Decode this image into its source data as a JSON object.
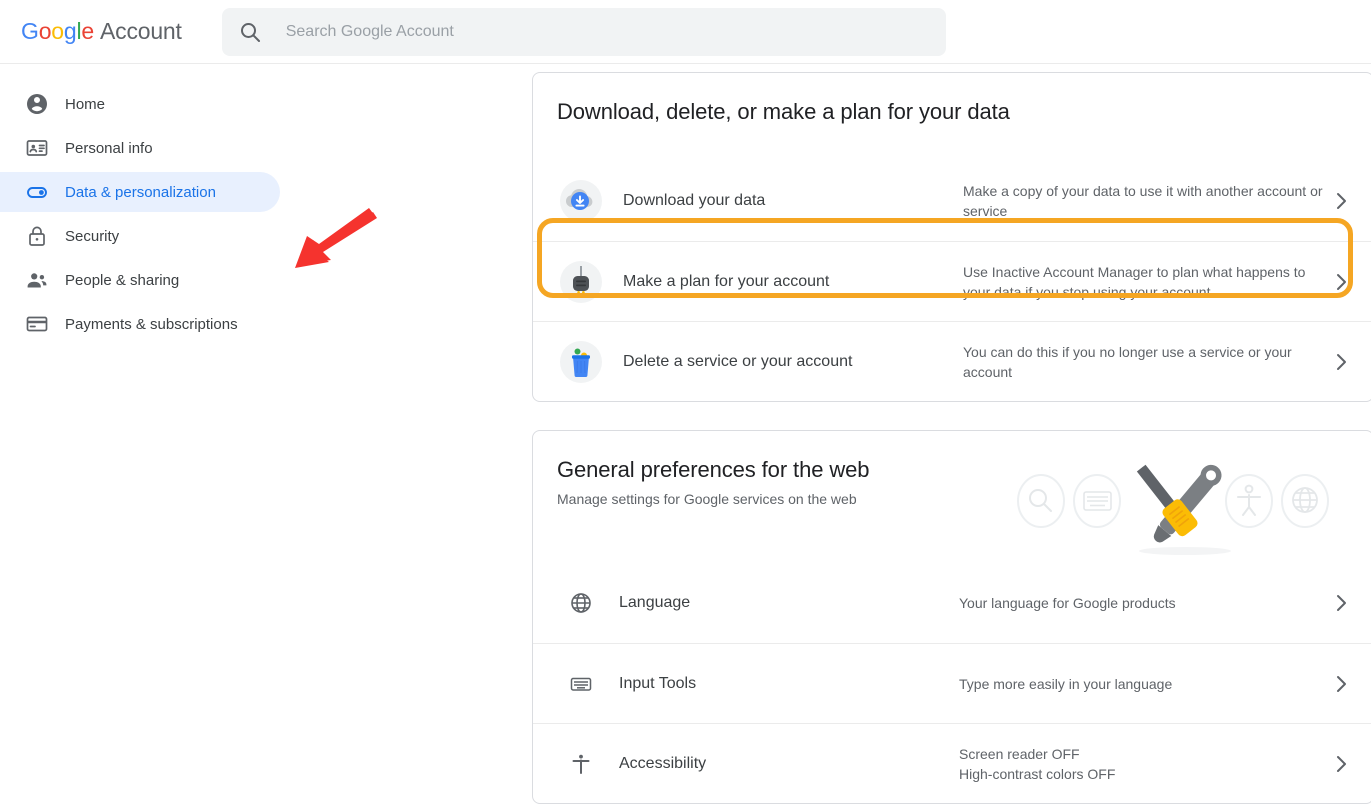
{
  "header": {
    "logo_text": "Google",
    "brand_word": "Account",
    "search_icon": "search-icon",
    "search_placeholder": "Search Google Account",
    "search_value": ""
  },
  "sidebar": {
    "items": [
      {
        "label": "Home",
        "icon": "account-circle-icon",
        "active": false
      },
      {
        "label": "Personal info",
        "icon": "contact-card-icon",
        "active": false
      },
      {
        "label": "Data & personalization",
        "icon": "toggle-switch-icon",
        "active": true
      },
      {
        "label": "Security",
        "icon": "lock-icon",
        "active": false
      },
      {
        "label": "People & sharing",
        "icon": "people-icon",
        "active": false
      },
      {
        "label": "Payments & subscriptions",
        "icon": "credit-card-icon",
        "active": false
      }
    ]
  },
  "main": {
    "cards": [
      {
        "title": "Download, delete, or make a plan for your data",
        "subtitle": "",
        "rows": [
          {
            "label": "Download your data",
            "description": "Make a copy of your data to use it with another account or service",
            "icon": "download-cloud-icon",
            "chevron": "chevron-right-icon"
          },
          {
            "label": "Make a plan for your account",
            "description": "Use Inactive Account Manager to plan what happens to your data if you stop using your account",
            "icon": "power-plug-icon",
            "chevron": "chevron-right-icon"
          },
          {
            "label": "Delete a service or your account",
            "description": "You can do this if you no longer use a service or your account",
            "icon": "trash-bin-icon",
            "chevron": "chevron-right-icon"
          }
        ]
      },
      {
        "title": "General preferences for the web",
        "subtitle": "Manage settings for Google services on the web",
        "illustration": "tools-wrench-screwdriver-illustration",
        "illustration_badges": [
          "search-icon",
          "keyboard-icon",
          "accessibility-icon",
          "globe-icon"
        ],
        "rows": [
          {
            "label": "Language",
            "description": "Your language for Google products",
            "icon": "globe-icon",
            "chevron": "chevron-right-icon"
          },
          {
            "label": "Input Tools",
            "description": "Type more easily in your language",
            "icon": "keyboard-icon",
            "chevron": "chevron-right-icon"
          },
          {
            "label": "Accessibility",
            "description": "Screen reader OFF\nHigh-contrast colors OFF",
            "icon": "accessibility-icon",
            "chevron": "chevron-right-icon"
          }
        ]
      }
    ]
  },
  "annotations": {
    "highlight_box": {
      "target": "Make a plan for your account",
      "color": "#f5a623"
    },
    "arrow": {
      "target": "Data & personalization",
      "color": "#f5332e"
    }
  },
  "colors": {
    "accent_blue": "#1a73e8",
    "active_pill_bg": "#e8f0fe",
    "search_bg": "#f1f3f4",
    "highlight_orange": "#f5a623",
    "arrow_red": "#f5332e",
    "text_primary": "#3c4043",
    "text_secondary": "#5f6368"
  }
}
